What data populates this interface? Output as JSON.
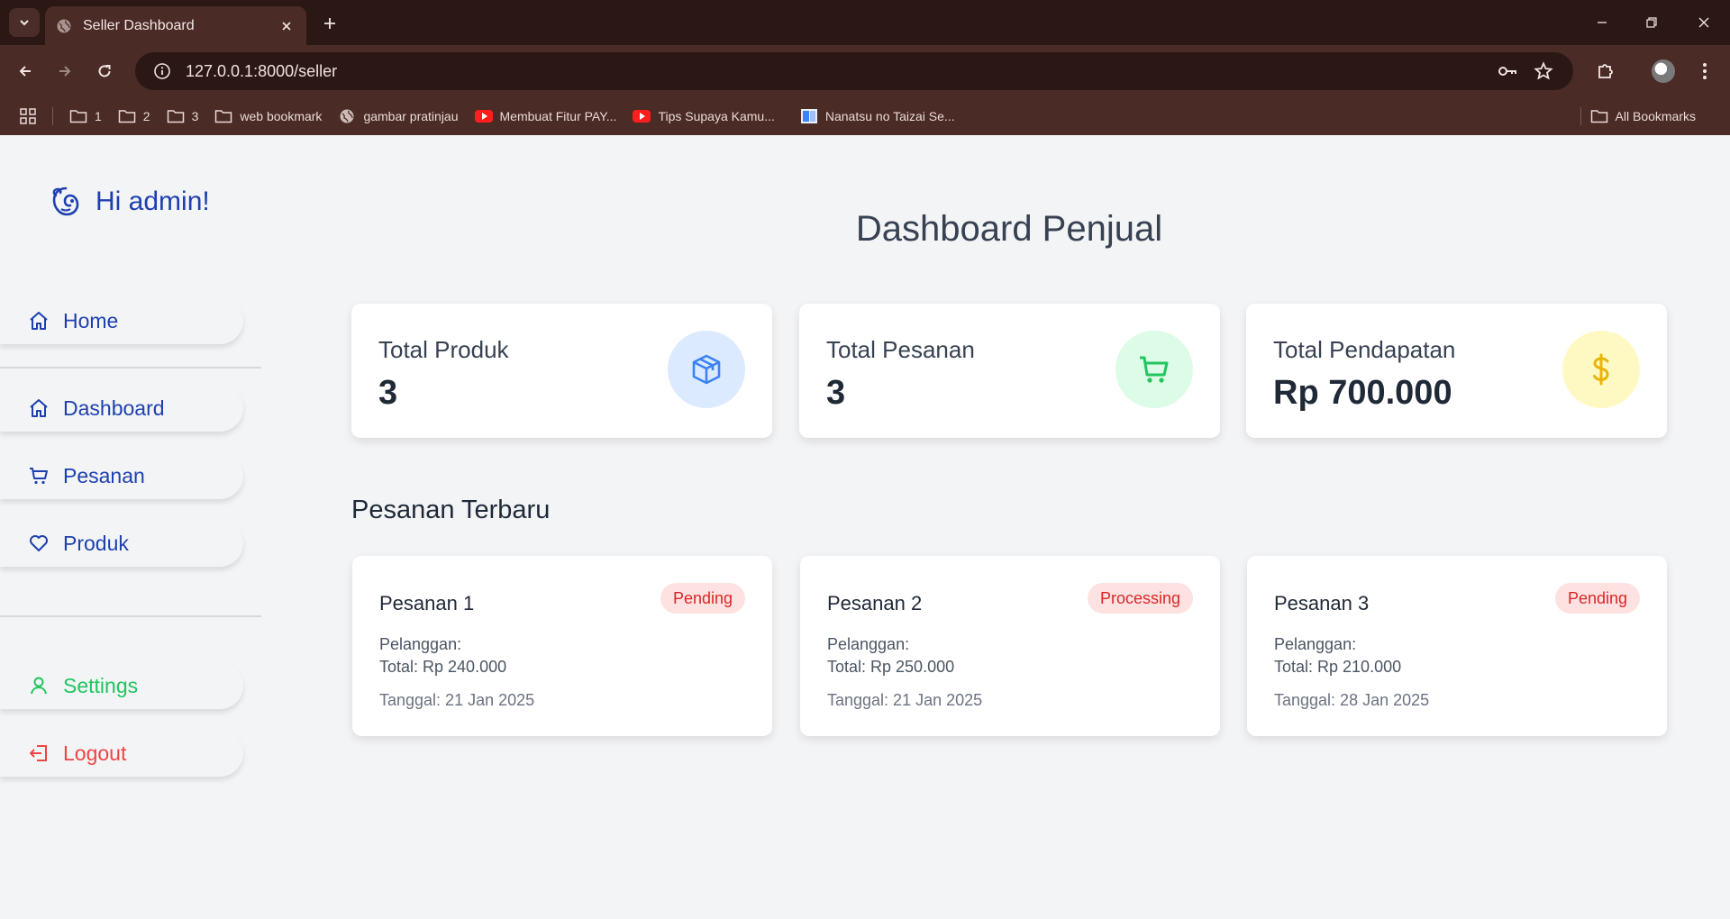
{
  "browser": {
    "tab_title": "Seller Dashboard",
    "url": "127.0.0.1:8000/seller",
    "bookmarks": [
      {
        "label": "1",
        "icon": "folder-icon"
      },
      {
        "label": "2",
        "icon": "folder-icon"
      },
      {
        "label": "3",
        "icon": "folder-icon"
      },
      {
        "label": "web bookmark",
        "icon": "folder-icon"
      },
      {
        "label": "gambar pratinjau",
        "icon": "globe-icon"
      },
      {
        "label": "Membuat Fitur PAY...",
        "icon": "youtube-icon"
      },
      {
        "label": "Tips Supaya Kamu...",
        "icon": "youtube-icon"
      },
      {
        "label": "Nanatsu no Taizai Se...",
        "icon": "book-icon"
      }
    ],
    "all_bookmarks": "All Bookmarks"
  },
  "sidebar": {
    "greeting": "Hi admin!",
    "items": [
      {
        "label": "Home",
        "icon": "home-icon"
      },
      {
        "label": "Dashboard",
        "icon": "home-icon"
      },
      {
        "label": "Pesanan",
        "icon": "cart-icon"
      },
      {
        "label": "Produk",
        "icon": "heart-icon"
      },
      {
        "label": "Settings",
        "icon": "user-icon"
      },
      {
        "label": "Logout",
        "icon": "logout-icon"
      }
    ]
  },
  "main": {
    "title": "Dashboard Penjual",
    "stats": [
      {
        "label": "Total Produk",
        "value": "3",
        "icon": "box-icon",
        "color": "#3b82f6",
        "bg": "#dbeafe"
      },
      {
        "label": "Total Pesanan",
        "value": "3",
        "icon": "cart-icon",
        "color": "#22c55e",
        "bg": "#dcfce7"
      },
      {
        "label": "Total Pendapatan",
        "value": "Rp 700.000",
        "icon": "dollar-icon",
        "color": "#eab308",
        "bg": "#fef9c3"
      }
    ],
    "recent_title": "Pesanan Terbaru",
    "orders": [
      {
        "title": "Pesanan 1",
        "status": "Pending",
        "customer": "Pelanggan:",
        "total": "Total: Rp 240.000",
        "date": "Tanggal: 21 Jan 2025"
      },
      {
        "title": "Pesanan 2",
        "status": "Processing",
        "customer": "Pelanggan:",
        "total": "Total: Rp 250.000",
        "date": "Tanggal: 21 Jan 2025"
      },
      {
        "title": "Pesanan 3",
        "status": "Pending",
        "customer": "Pelanggan:",
        "total": "Total: Rp 210.000",
        "date": "Tanggal: 28 Jan 2025"
      }
    ]
  },
  "colors": {
    "accent": "#1e40af",
    "success": "#22c55e",
    "danger": "#ef4444"
  }
}
